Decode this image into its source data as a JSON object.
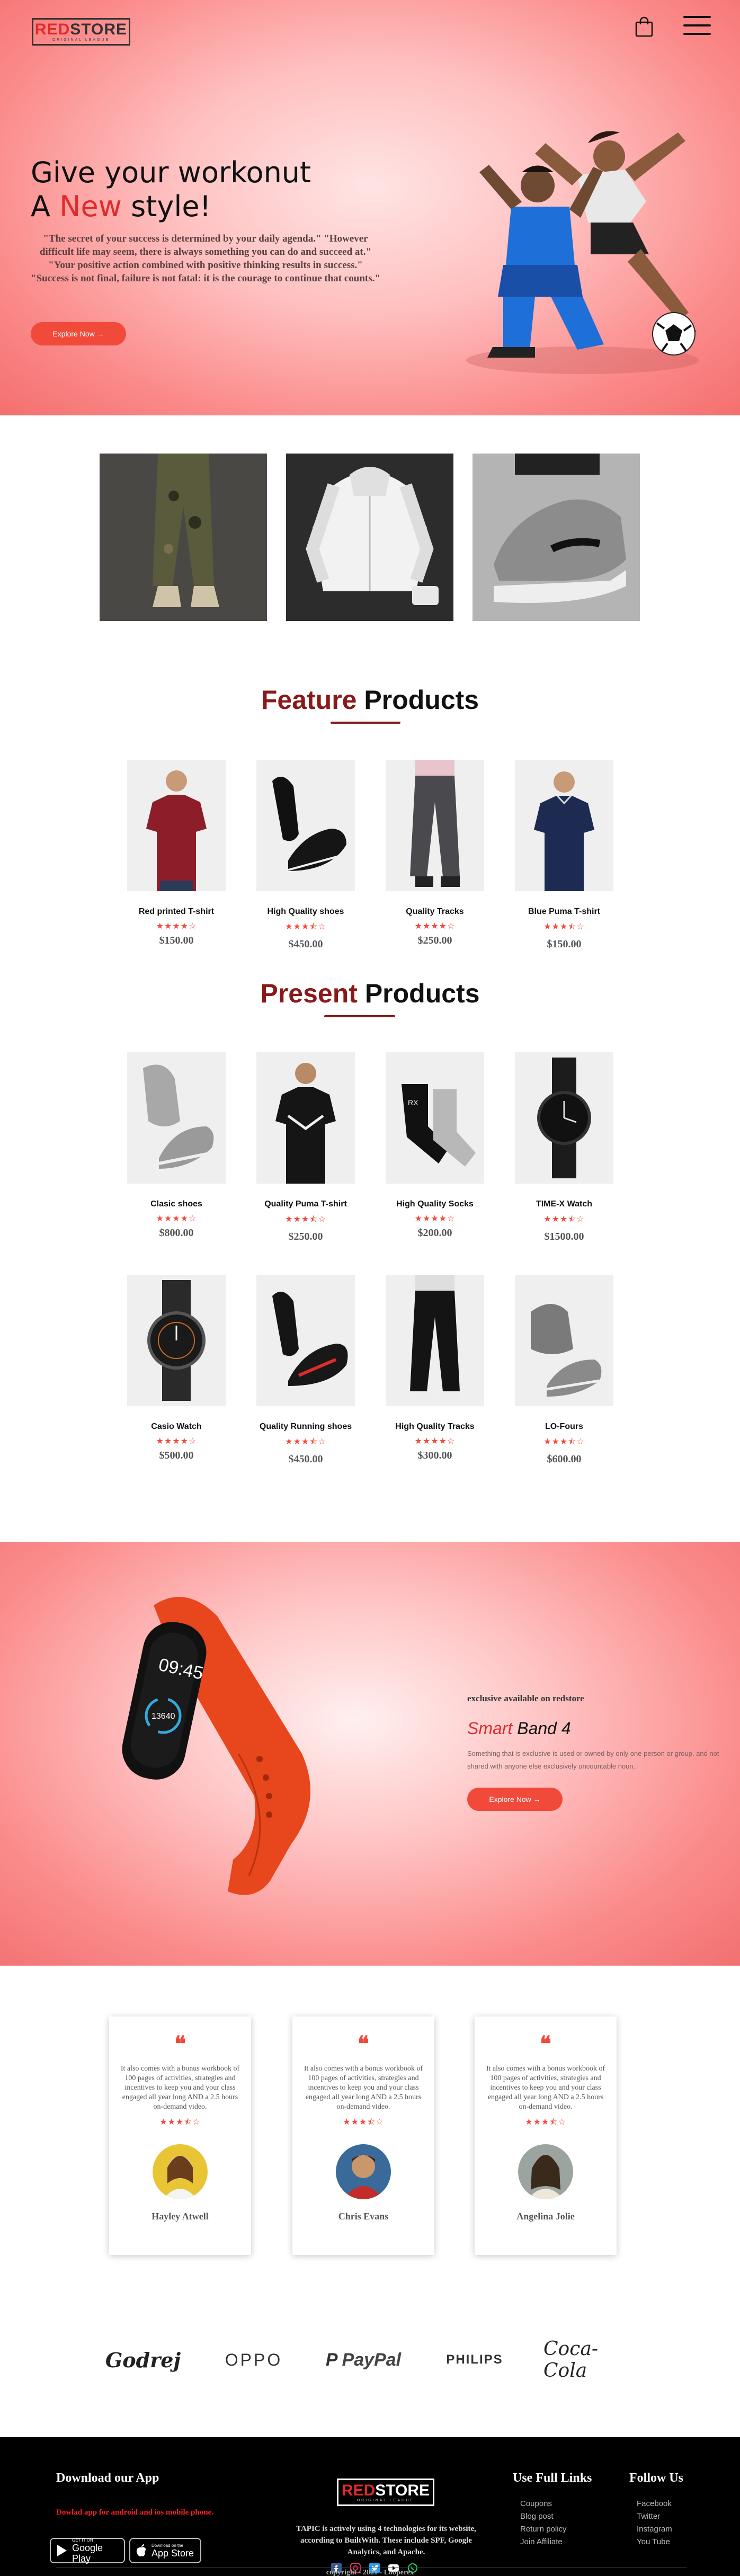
{
  "header": {
    "logo_red": "RED",
    "logo_dark": "STORE",
    "logo_tagline": "ORIGINAL LEAGUE"
  },
  "hero": {
    "title_line1": "Give your workonut",
    "title_a": "A",
    "title_accent": "New",
    "title_end": "style!",
    "quote": "\"The secret of your success is determined by your daily agenda.\" \"However difficult life may seem, there is always something you can do and succeed at.\" \"Your positive action combined with positive thinking results in success.\" \"Success is not final, failure is not fatal: it is the courage to continue that counts.\"",
    "button": "Explore Now →"
  },
  "feature": {
    "title_accent": "Feature",
    "title_rest": "Products",
    "items": [
      {
        "name": "Red printed T-shirt",
        "stars": "★★★★☆",
        "price": "$150.00"
      },
      {
        "name": "High Quality shoes",
        "stars": "★★★⯪☆",
        "price": "$450.00"
      },
      {
        "name": "Quality Tracks",
        "stars": "★★★★☆",
        "price": "$250.00"
      },
      {
        "name": "Blue Puma T-shirt",
        "stars": "★★★⯪☆",
        "price": "$150.00"
      }
    ]
  },
  "present": {
    "title_accent": "Present",
    "title_rest": "Products",
    "items": [
      {
        "name": "Clasic shoes",
        "stars": "★★★★☆",
        "price": "$800.00"
      },
      {
        "name": "Quality Puma T-shirt",
        "stars": "★★★⯪☆",
        "price": "$250.00"
      },
      {
        "name": "High Quality Socks",
        "stars": "★★★★☆",
        "price": "$200.00"
      },
      {
        "name": "TIME-X Watch",
        "stars": "★★★⯪☆",
        "price": "$1500.00"
      },
      {
        "name": "Casio Watch",
        "stars": "★★★★☆",
        "price": "$500.00"
      },
      {
        "name": "Quality Running shoes",
        "stars": "★★★⯪☆",
        "price": "$450.00"
      },
      {
        "name": "High Quality Tracks",
        "stars": "★★★★☆",
        "price": "$300.00"
      },
      {
        "name": "LO-Fours",
        "stars": "★★★⯪☆",
        "price": "$600.00"
      }
    ]
  },
  "band": {
    "watch_time": "09:45",
    "watch_steps": "13640",
    "exclusive": "exclusive available on redstore",
    "title_accent": "Smart",
    "title_rest": "Band 4",
    "desc": "Something that is exclusive is used or owned by only one person or group, and not shared with anyone else exclusively uncountable noun.",
    "button": "Explore Now →"
  },
  "testimonials": [
    {
      "text": "It also comes with a bonus workbook of 100 pages of activities, strategies and incentives to keep you and your class engaged all year long AND a 2.5 hours on-demand video.",
      "stars": "★★★⯪☆",
      "name": "Hayley Atwell"
    },
    {
      "text": "It also comes with a bonus workbook of 100 pages of activities, strategies and incentives to keep you and your class engaged all year long AND a 2.5 hours on-demand video.",
      "stars": "★★★⯪☆",
      "name": "Chris Evans"
    },
    {
      "text": "It also comes with a bonus workbook of 100 pages of activities, strategies and incentives to keep you and your class engaged all year long AND a 2.5 hours on-demand video.",
      "stars": "★★★⯪☆",
      "name": "Angelina Jolie"
    }
  ],
  "brands": [
    "Godrej",
    "OPPO",
    "PayPal",
    "PHILIPS",
    "Coca-Cola"
  ],
  "footer": {
    "download_heading": "Download our App",
    "download_text": "Dowlad app for android and ios mobile phone.",
    "google_small": "GET IT ON",
    "google_big": "Google Play",
    "apple_small": "Download on the",
    "apple_big": "App Store",
    "logo_red": "RED",
    "logo_white": "STORE",
    "logo_tagline": "ORIGINAL LEAGUE",
    "desc": "TAPIC is actively using 4 technologies for its website, according to BuiltWith. These include SPF, Google Analytics, and Apache.",
    "useful_heading": "Use Full Links",
    "useful_links": [
      "Coupons",
      "Blog post",
      "Return policy",
      "Join Affiliate"
    ],
    "follow_heading": "Follow Us",
    "follow_links": [
      "Facebook",
      "Twitter",
      "Instagram",
      "You Tube"
    ],
    "copyright": "copyright - 2021 - Looperex"
  },
  "colors": {
    "accent": "#f24a3a",
    "title_accent": "#8a1a1a",
    "hero_pink": "#fb8a8a"
  }
}
